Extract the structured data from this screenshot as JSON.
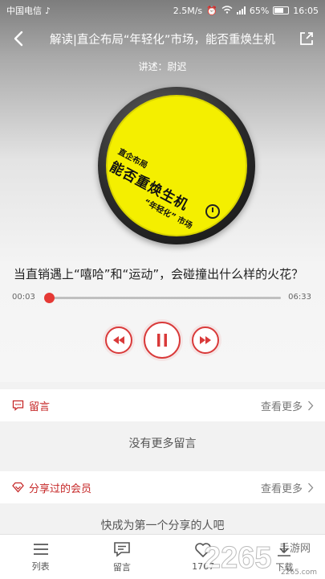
{
  "status_bar": {
    "carrier": "中国电信",
    "speed": "2.5M/s",
    "battery": "65%",
    "battery_level": 0.65,
    "time": "16:05"
  },
  "header": {
    "title": "解读|直企布局“年轻化”市场，能否重焕生机",
    "speaker": "讲述：尉迟"
  },
  "cover": {
    "line1": "直企布局",
    "line2": "能否重焕生机",
    "line3": "“年轻化” 市场"
  },
  "question": "当直销遇上“嘻哈”和“运动”，会碰撞出什么样的火花？",
  "player": {
    "current_time": "00:03",
    "total_time": "06:33",
    "progress": 0.01
  },
  "comments": {
    "title": "留言",
    "more": "查看更多",
    "empty": "没有更多留言"
  },
  "shared": {
    "title": "分享过的会员",
    "more": "查看更多",
    "empty": "快成为第一个分享的人吧"
  },
  "tabs": [
    {
      "label": "列表",
      "icon": "list-icon"
    },
    {
      "label": "留言",
      "icon": "comment-icon"
    },
    {
      "label": "1767",
      "icon": "heart-icon"
    },
    {
      "label": "下载",
      "icon": "download-icon"
    }
  ],
  "watermark": {
    "text": "2265",
    "sub": "手游网",
    "url": "2265.com"
  },
  "colors": {
    "accent": "#d93a3a",
    "cover_yellow": "#f4ef00"
  }
}
